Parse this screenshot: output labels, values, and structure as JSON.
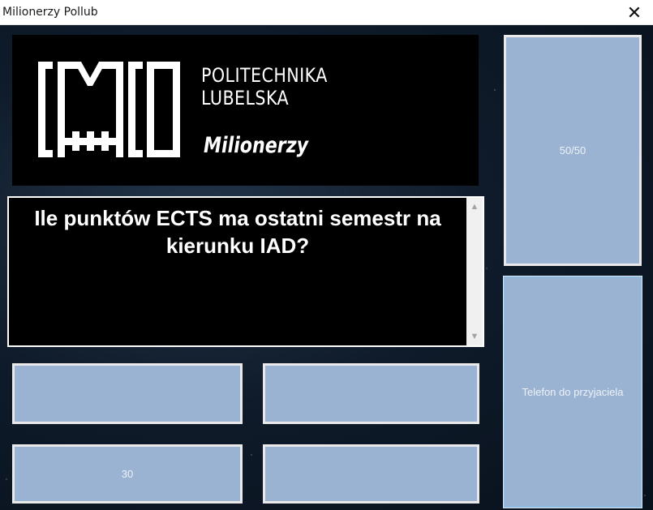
{
  "window": {
    "title": "Milionerzy Pollub"
  },
  "logo": {
    "line1": "POLITECHNIKA",
    "line2": "LUBELSKA",
    "brand": "Milionerzy"
  },
  "question": {
    "text": "Ile punktów ECTS ma ostatni semestr na kierunku IAD?"
  },
  "answers": {
    "a": "",
    "b": "",
    "c": "30",
    "d": ""
  },
  "lifelines": {
    "fifty_fifty": "50/50",
    "phone": "Telefon do przyjaciela"
  },
  "icons": {
    "close": "close-icon",
    "scroll_up": "scroll-up-arrow-icon",
    "scroll_down": "scroll-down-arrow-icon"
  },
  "colors": {
    "button_fill": "#9ab3d2",
    "panel_background": "#000000",
    "space_background": "#0f1b2a"
  }
}
